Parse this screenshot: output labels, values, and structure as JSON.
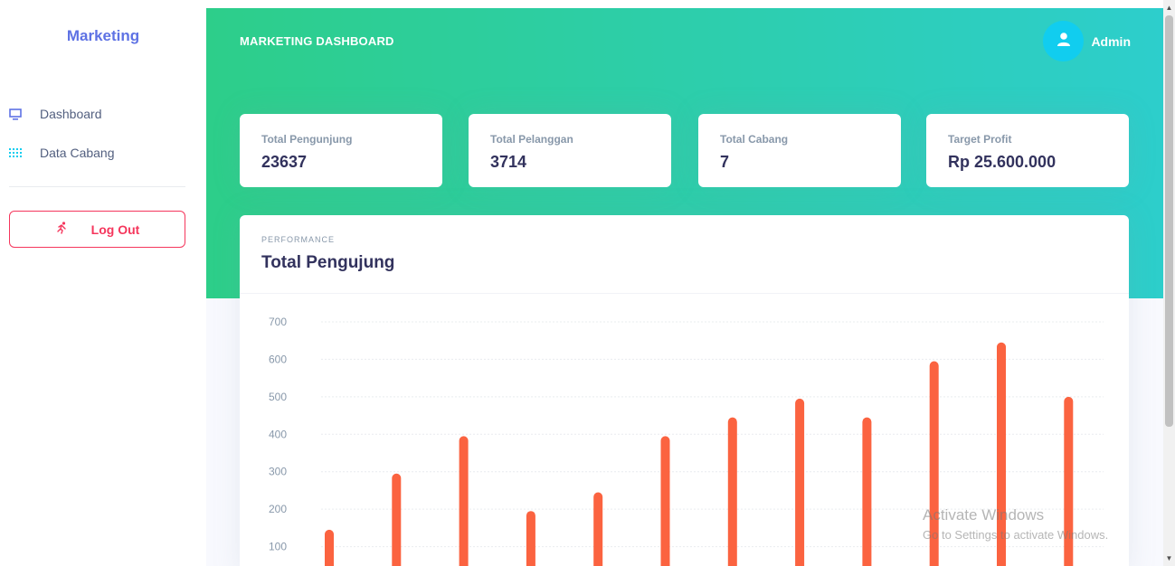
{
  "sidebar": {
    "brand": "Marketing",
    "items": [
      {
        "label": "Dashboard",
        "icon": "monitor-icon"
      },
      {
        "label": "Data Cabang",
        "icon": "grid-dots-icon"
      }
    ],
    "logout_label": "Log Out",
    "logout_icon": "running-person-icon"
  },
  "header": {
    "title": "MARKETING DASHBOARD",
    "user_name": "Admin",
    "user_icon": "user-icon"
  },
  "stats": [
    {
      "label": "Total Pengunjung",
      "value": "23637"
    },
    {
      "label": "Total Pelanggan",
      "value": "3714"
    },
    {
      "label": "Total Cabang",
      "value": "7"
    },
    {
      "label": "Target Profit",
      "value": "Rp 25.600.000"
    }
  ],
  "performance": {
    "eyebrow": "PERFORMANCE",
    "title": "Total Pengujung"
  },
  "chart_data": {
    "type": "bar",
    "values": [
      145,
      295,
      395,
      195,
      245,
      395,
      445,
      495,
      445,
      595,
      645,
      500
    ],
    "y_ticks": [
      "100",
      "200",
      "300",
      "400",
      "500",
      "600",
      "700"
    ],
    "ylim": [
      0,
      700
    ],
    "grid": true,
    "bar_color": "#fb6340"
  },
  "watermark": {
    "line1": "Activate Windows",
    "line2": "Go to Settings to activate Windows."
  },
  "colors": {
    "brand": "#5e72e4",
    "gradient_start": "#2dce89",
    "gradient_end": "#2dcecc",
    "danger": "#f5365c",
    "avatar": "#11cdef"
  }
}
